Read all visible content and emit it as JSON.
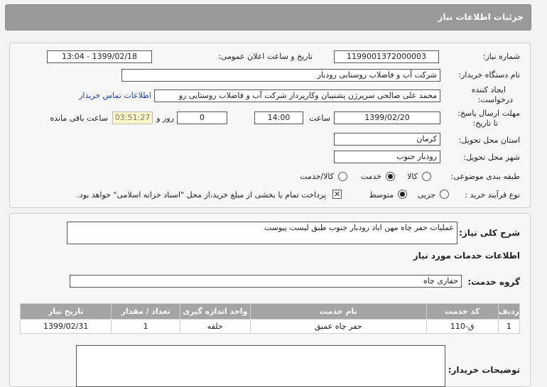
{
  "header": {
    "title": "جزئیات اطلاعات نیاز"
  },
  "form": {
    "need_number_label": "شماره نیاز:",
    "need_number": "1199001372000003",
    "announce_label": "تاریخ و ساعت اعلان عمومی:",
    "announce_value": "1399/02/18 - 13:04",
    "buyer_org_label": "نام دستگاه خریدار:",
    "buyer_org": "شرکت آب و فاضلاب روستایی رودبار",
    "creator_label_1": "ایجاد کننده",
    "creator_label_2": "درخواست:",
    "creator": "محمد علی  صالحی سرپرژن پشتیبان وکارپرداز شرکت آب و فاضلاب روستایی رو",
    "contact_link": "اطلاعات تماس خریدار",
    "deadline_label_1": "مهلت ارسال پاسخ:",
    "deadline_label_2": "تا تاریخ:",
    "deadline_date": "1399/02/20",
    "time_label": "ساعت",
    "deadline_time": "14:00",
    "days_value": "0",
    "days_label": "روز و",
    "remaining_time": "03:51:27",
    "remaining_label": "ساعت باقی مانده",
    "province_label": "استان محل تحویل:",
    "province": "کرمان",
    "city_label": "شهر محل تحویل:",
    "city": "رودبار جنوب",
    "category_label": "طبقه بندی موضوعی:",
    "category_options": [
      "کالا",
      "خدمت",
      "کالا/خدمت"
    ],
    "category_selected": "خدمت",
    "process_label": "نوع فرآیند خرید :",
    "process_options": [
      "جزیی",
      "متوسط"
    ],
    "process_selected": "متوسط",
    "payment_note": "پرداخت تمام یا بخشی از مبلغ خرید،از محل \"اسناد خزانه اسلامی\" خواهد بود."
  },
  "details": {
    "summary_label": "شرح کلی نیاز:",
    "summary": "عملیات حفر چاه مهن اباد رودبار جنوب طبق لیست پیوست",
    "services_title": "اطلاعات خدمات مورد نیاز",
    "group_label": "گروه خدمت:",
    "group": "حفاری چاه",
    "table": {
      "headers": [
        "ردیف",
        "کد خدمت",
        "نام خدمت",
        "واحد اندازه گیری",
        "تعداد / مقدار",
        "تاریخ نیاز"
      ],
      "rows": [
        [
          "1",
          "ق-110",
          "حفر چاه عمیق",
          "حلقه",
          "1",
          "1399/02/31"
        ]
      ]
    },
    "buyer_notes_label": "توضیحات خریدار:",
    "buyer_notes": ""
  }
}
